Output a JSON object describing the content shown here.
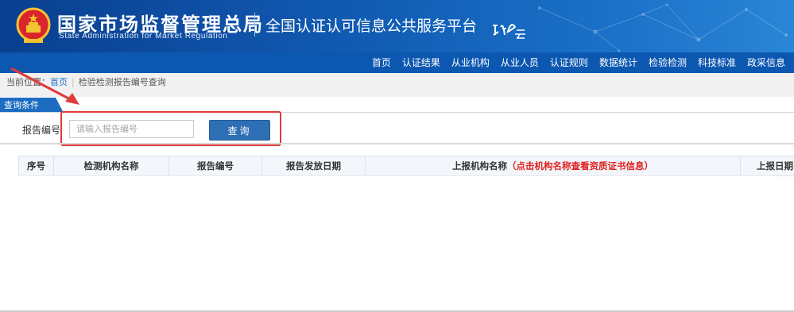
{
  "header": {
    "org_name": "国家市场监督管理总局",
    "org_name_en": "State Administration  for  Market Regulation",
    "platform_title": "全国认证认可信息公共服务平台",
    "colors": {
      "header_blue": "#115bb3",
      "nav_blue": "#0c57b0",
      "accent_red": "#e03b3b"
    }
  },
  "nav": {
    "items": [
      "首页",
      "认证结果",
      "从业机构",
      "从业人员",
      "认证规则",
      "数据统计",
      "检验检测",
      "科技标准",
      "政采信息"
    ]
  },
  "breadcrumb": {
    "prefix": "当前位置：",
    "home": "首页",
    "current": "检验检测报告编号查询"
  },
  "query": {
    "tab_label": "查询条件",
    "field_label": "报告编号",
    "placeholder": "请输入报告编号",
    "value": "",
    "button_label": "查询"
  },
  "table": {
    "columns": [
      "序号",
      "检测机构名称",
      "报告编号",
      "报告发放日期",
      "上报机构名称",
      "上报日期"
    ],
    "column_note": "（点击机构名称查看资质证书信息）",
    "rows": []
  }
}
